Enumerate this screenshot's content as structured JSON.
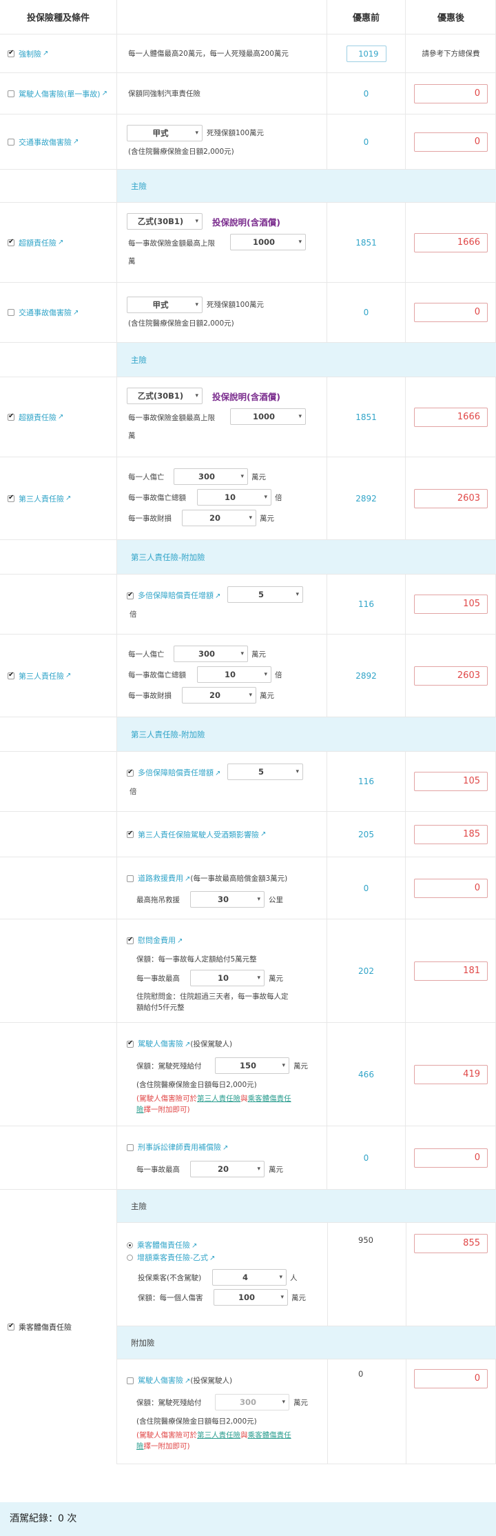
{
  "header": {
    "col_type": "投保險種及條件",
    "col_before": "優惠前",
    "col_after": "優惠後"
  },
  "r1": {
    "label": "強制險",
    "desc": "每一人體傷最高20萬元，每一人死殘最高200萬元",
    "before": "1019",
    "after": "請參考下方總保費"
  },
  "r2": {
    "label": "駕駛人傷害險(單一事故)",
    "desc": "保額同強制汽車責任險",
    "before": "0",
    "after": "0"
  },
  "r3": {
    "label": "交通事故傷害險",
    "plan": "甲式",
    "text1": "死殘保額100萬元",
    "text2": "(含住院醫療保險金日額2,000元)",
    "before": "0",
    "after": "0"
  },
  "band1": "主險",
  "r4": {
    "label": "超額責任險",
    "plan": "乙式(30B1)",
    "explain": "投保說明(含酒償)",
    "text1": "每一事故保險金額最高上限",
    "amount": "1000",
    "unit": "萬",
    "before": "1851",
    "after": "1666"
  },
  "r5": {
    "label": "交通事故傷害險",
    "plan": "甲式",
    "text1": "死殘保額100萬元",
    "text2": "(含住院醫療保險金日額2,000元)",
    "before": "0",
    "after": "0"
  },
  "band2": "主險",
  "r6": {
    "label": "超額責任險",
    "plan": "乙式(30B1)",
    "explain": "投保說明(含酒償)",
    "text1": "每一事故保險金額最高上限",
    "amount": "1000",
    "unit": "萬",
    "before": "1851",
    "after": "1666"
  },
  "r7": {
    "label": "第三人責任險",
    "l1": "每一人傷亡",
    "v1": "300",
    "u1": "萬元",
    "l2": "每一事故傷亡總額",
    "v2": "10",
    "u2": "倍",
    "l3": "每一事故財損",
    "v3": "20",
    "u3": "萬元",
    "before": "2892",
    "after": "2603"
  },
  "band3": "第三人責任險-附加險",
  "r8": {
    "label": "多倍保障賠償責任增額",
    "v": "5",
    "unit": "倍",
    "before": "116",
    "after": "105"
  },
  "r9": {
    "label": "第三人責任險",
    "l1": "每一人傷亡",
    "v1": "300",
    "u1": "萬元",
    "l2": "每一事故傷亡總額",
    "v2": "10",
    "u2": "倍",
    "l3": "每一事故財損",
    "v3": "20",
    "u3": "萬元",
    "before": "2892",
    "after": "2603"
  },
  "band4": "第三人責任險-附加險",
  "r10": {
    "label": "多倍保障賠償責任增額",
    "v": "5",
    "unit": "倍",
    "before": "116",
    "after": "105"
  },
  "r11": {
    "label": "第三人責任保險駕駛人受酒類影響險",
    "before": "205",
    "after": "185"
  },
  "r12": {
    "label": "道路救援費用",
    "label2": "(每一事故最高賠償金額3萬元)",
    "l1": "最高拖吊救援",
    "v1": "30",
    "u1": "公里",
    "before": "0",
    "after": "0"
  },
  "r13": {
    "label": "慰問金費用",
    "t1": "保額：每一事故每人定額給付5萬元整",
    "l1": "每一事故最高",
    "v1": "10",
    "u1": "萬元",
    "t2": "住院慰問金：住院超過三天者，每一事故每人定",
    "t3": "額給付5仟元整",
    "before": "202",
    "after": "181"
  },
  "r14": {
    "label": "駕駛人傷害險",
    "label2": "(投保駕駛人)",
    "l1": "保額：駕駛死殘給付",
    "v1": "150",
    "u1": "萬元",
    "t1": "(含住院醫療保險金日額每日2,000元)",
    "n1": "(駕駛人傷害險可於",
    "n2": "第三人責任險",
    "n3": "與",
    "n4": "乘客體傷責任",
    "n5": "險",
    "n6": "擇一附加即可)",
    "before": "466",
    "after": "419"
  },
  "r15": {
    "label": "刑事訴訟律師費用補償險",
    "l1": "每一事故最高",
    "v1": "20",
    "u1": "萬元",
    "before": "0",
    "after": "0"
  },
  "group": {
    "label": "乘客體傷責任險"
  },
  "band5": "主險",
  "r16": {
    "radio1": "乘客體傷責任險",
    "radio2": "增額乘客責任險-乙式",
    "l1": "投保乘客(不含駕駛)",
    "v1": "4",
    "u1": "人",
    "l2": "保額：每一個人傷害",
    "v2": "100",
    "u2": "萬元",
    "before": "950",
    "after": "855"
  },
  "band6": "附加險",
  "r17": {
    "label": "駕駛人傷害險",
    "label2": "(投保駕駛人)",
    "l1": "保額：駕駛死殘給付",
    "v1": "300",
    "u1": "萬元",
    "t1": "(含住院醫療保險金日額每日2,000元)",
    "n1": "(駕駛人傷害險可於",
    "n2": "第三人責任險",
    "n3": "與",
    "n4": "乘客體傷責任",
    "n5": "險",
    "n6": "擇一附加即可)",
    "before": "0",
    "after": "0"
  },
  "footer": "酒駕紀錄：0 次"
}
